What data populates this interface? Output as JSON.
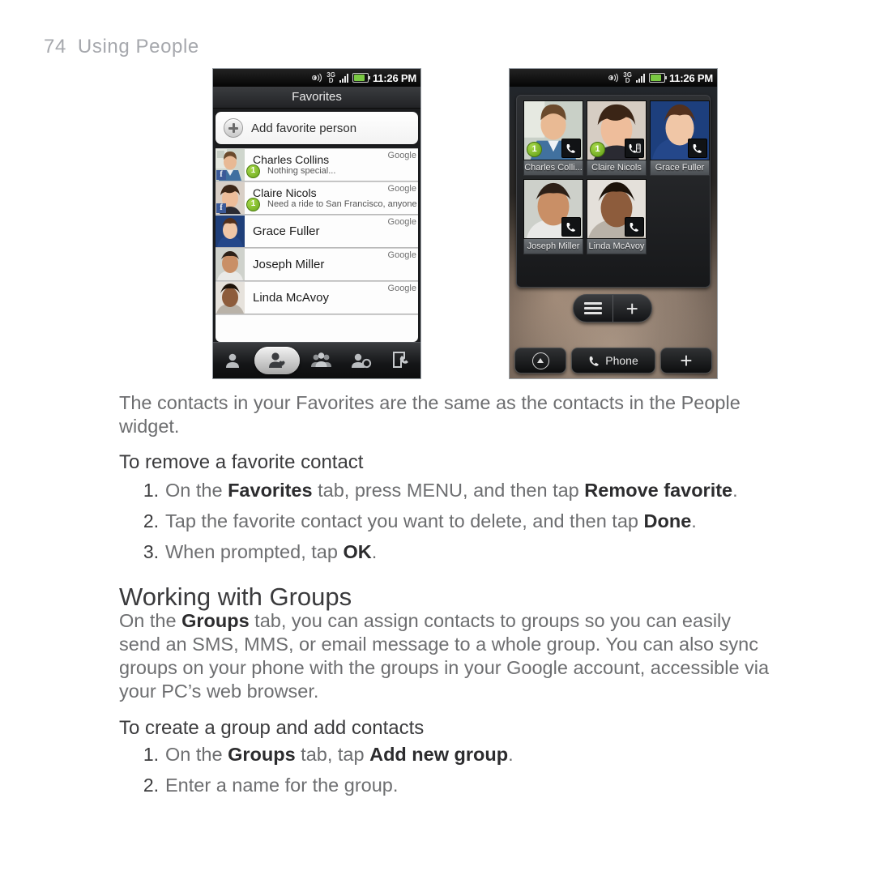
{
  "running_head": {
    "page_number": "74",
    "title": "Using People"
  },
  "figure_left": {
    "status_bar": {
      "time": "11:26 PM",
      "network": "3G",
      "network_sub": "D",
      "icons": [
        "location-icon",
        "3g-icon",
        "signal-icon",
        "battery-icon"
      ]
    },
    "app_title": "Favorites",
    "add_favorite": "Add favorite person",
    "account_label": "Google",
    "contacts": [
      {
        "name": "Charles Collins",
        "status": "Nothing special...",
        "account": "Google",
        "badge": "1",
        "facebook": "f",
        "has_status": true
      },
      {
        "name": "Claire Nicols",
        "status": "Need a ride to San Francisco, anyone go",
        "account": "Google",
        "badge": "1",
        "facebook": "f",
        "has_status": true
      },
      {
        "name": "Grace Fuller",
        "status": "",
        "account": "Google",
        "badge": "",
        "facebook": "",
        "has_status": false
      },
      {
        "name": "Joseph Miller",
        "status": "",
        "account": "Google",
        "badge": "",
        "facebook": "",
        "has_status": false
      },
      {
        "name": "Linda McAvoy",
        "status": "",
        "account": "Google",
        "badge": "",
        "facebook": "",
        "has_status": false
      }
    ],
    "tabs": [
      {
        "name": "all-contacts",
        "selected": false
      },
      {
        "name": "favorites",
        "selected": true
      },
      {
        "name": "groups",
        "selected": false
      },
      {
        "name": "online",
        "selected": false
      },
      {
        "name": "call-history",
        "selected": false
      }
    ]
  },
  "figure_right": {
    "status_bar": {
      "time": "11:26 PM",
      "network": "3G",
      "network_sub": "D"
    },
    "widget_tiles": [
      {
        "name": "Charles Colli...",
        "badge": "1",
        "call_icon": "phone-icon"
      },
      {
        "name": "Claire Nicols",
        "badge": "1",
        "call_icon": "phone-keypad-icon"
      },
      {
        "name": "Grace Fuller",
        "badge": "",
        "call_icon": "phone-icon"
      },
      {
        "name": "Joseph Miller",
        "badge": "",
        "call_icon": "phone-icon"
      },
      {
        "name": "Linda McAvoy",
        "badge": "",
        "call_icon": "phone-icon"
      }
    ],
    "widget_controls": [
      {
        "name": "menu-button",
        "icon": "hamburger-icon"
      },
      {
        "name": "add-button",
        "icon": "plus-icon",
        "label": "+"
      }
    ],
    "dock": {
      "left_button": "app-drawer-icon",
      "phone_button": "Phone",
      "right_button": "+"
    }
  },
  "content": {
    "intro_paragraph": "The contacts in your Favorites are the same as the contacts in the People widget.",
    "section_remove": {
      "heading": "To remove a favorite contact",
      "steps": [
        {
          "num": "1.",
          "parts": [
            {
              "t": "On the ",
              "b": false
            },
            {
              "t": "Favorites",
              "b": true
            },
            {
              "t": " tab, press MENU, and then tap ",
              "b": false
            },
            {
              "t": "Remove favorite",
              "b": true
            },
            {
              "t": ".",
              "b": false
            }
          ]
        },
        {
          "num": "2.",
          "parts": [
            {
              "t": "Tap the favorite contact you want to delete, and then tap ",
              "b": false
            },
            {
              "t": "Done",
              "b": true
            },
            {
              "t": ".",
              "b": false
            }
          ]
        },
        {
          "num": "3.",
          "parts": [
            {
              "t": "When prompted, tap ",
              "b": false
            },
            {
              "t": "OK",
              "b": true
            },
            {
              "t": ".",
              "b": false
            }
          ]
        }
      ]
    },
    "section_groups": {
      "heading": "Working with Groups",
      "paragraph_parts": [
        {
          "t": "On the ",
          "b": false
        },
        {
          "t": "Groups",
          "b": true
        },
        {
          "t": " tab, you can assign contacts to groups so you can easily send an SMS, MMS, or email message to a whole group. You can also sync groups on your phone with the groups in your Google account, accessible via your PC’s web browser.",
          "b": false
        }
      ],
      "sub_heading": "To create a group and add contacts",
      "steps": [
        {
          "num": "1.",
          "parts": [
            {
              "t": "On the ",
              "b": false
            },
            {
              "t": "Groups",
              "b": true
            },
            {
              "t": " tab, tap ",
              "b": false
            },
            {
              "t": "Add new group",
              "b": true
            },
            {
              "t": ".",
              "b": false
            }
          ]
        },
        {
          "num": "2.",
          "parts": [
            {
              "t": "Enter a name for the group.",
              "b": false
            }
          ]
        }
      ]
    }
  },
  "colors": {
    "body_text": "#6d6e70",
    "bold_text": "#2c2c2e",
    "heading": "#3a3a3c",
    "running_head": "#a6a8ad",
    "badge_green": "#6aa81b",
    "facebook_blue": "#3b5998"
  }
}
